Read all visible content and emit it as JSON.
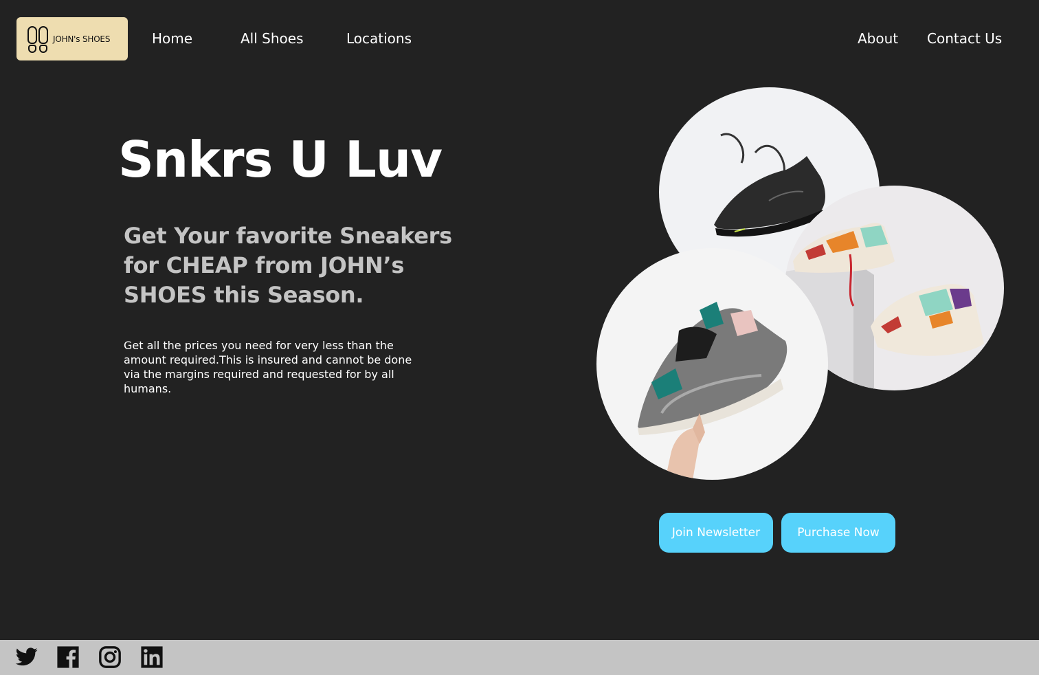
{
  "brand": {
    "name": "JOHN's SHOES",
    "logo_bg": "#eeddb0"
  },
  "nav": {
    "left": [
      "Home",
      "All Shoes",
      "Locations"
    ],
    "right": [
      "About",
      "Contact Us"
    ]
  },
  "hero": {
    "title": "Snkrs U Luv",
    "subtitle": "Get Your favorite Sneakers for CHEAP from JOHN’s SHOES this Season.",
    "description": "Get all the prices you need for very less than the amount required.This is insured and cannot be done via the margins required and requested for by all humans."
  },
  "images": [
    {
      "icon": "black-sneaker-photo"
    },
    {
      "icon": "colorful-sneakers-on-box-photo"
    },
    {
      "icon": "hand-holding-sneaker-photo"
    }
  ],
  "buttons": {
    "newsletter": "Join Newsletter",
    "purchase": "Purchase Now",
    "color": "#57d2fb"
  },
  "footer": {
    "social": [
      "twitter-icon",
      "facebook-icon",
      "instagram-icon",
      "linkedin-icon"
    ],
    "bg": "#c4c4c4"
  },
  "colors": {
    "background": "#222222",
    "text": "#ffffff",
    "subtitle": "#c4c4c4"
  }
}
